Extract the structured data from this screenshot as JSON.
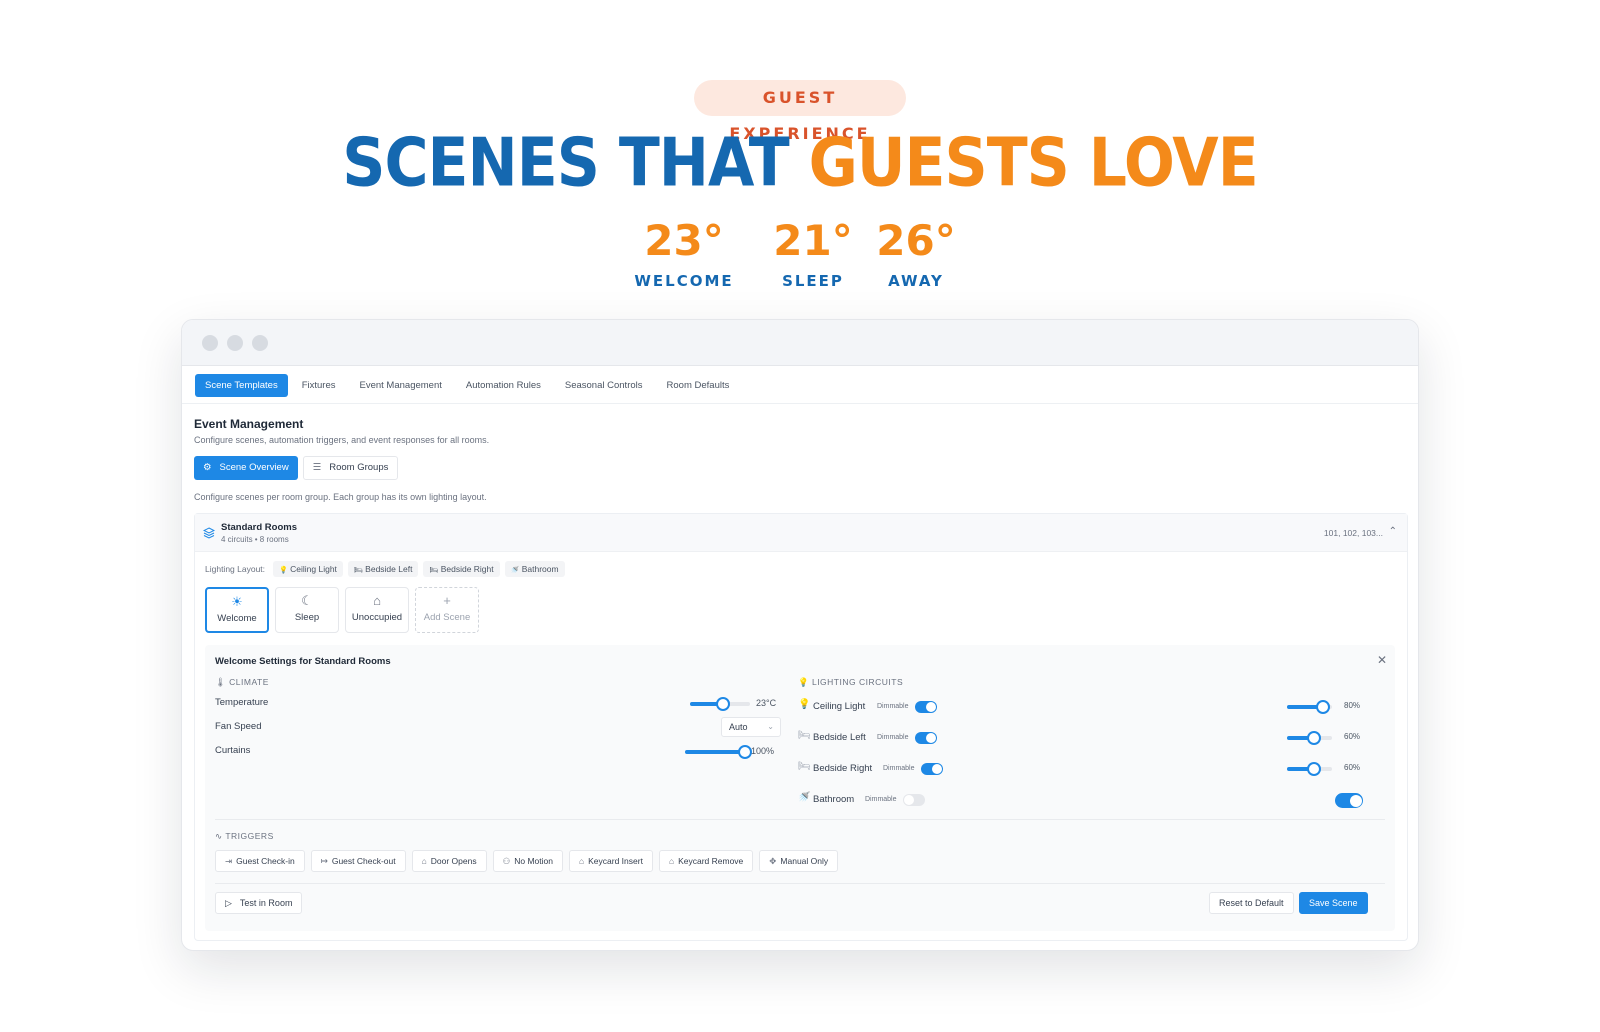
{
  "hero": {
    "pill": "GUEST EXPERIENCE",
    "headline_part1": "SCENES THAT",
    "headline_part2": "GUESTS LOVE",
    "stats": [
      {
        "value": "23°",
        "label": "WELCOME"
      },
      {
        "value": "21°",
        "label": "SLEEP"
      },
      {
        "value": "26°",
        "label": "AWAY"
      }
    ],
    "colors": {
      "blue": "#1568b0",
      "orange": "#f48a1a",
      "pill_bg": "#fde8df",
      "pill_text": "#d9532b"
    }
  },
  "app": {
    "accent": "#1e88e5",
    "tabs": [
      "Scene Templates",
      "Fixtures",
      "Event Management",
      "Automation Rules",
      "Seasonal Controls",
      "Room Defaults"
    ],
    "active_tab": "Scene Templates",
    "section": {
      "title": "Event Management",
      "subtitle": "Configure scenes, automation triggers, and event responses for all rooms."
    },
    "segments": [
      {
        "label": "Scene Overview",
        "icon": "gear-icon",
        "active": true
      },
      {
        "label": "Room Groups",
        "icon": "layers-icon",
        "active": false
      }
    ],
    "segment_description": "Configure scenes per room group. Each group has its own lighting layout.",
    "group": {
      "name": "Standard Rooms",
      "meta": "4 circuits • 8 rooms",
      "rooms": "101, 102, 103...",
      "lighting_layout_label": "Lighting Layout:",
      "lighting_layout": [
        {
          "icon": "💡",
          "label": "Ceiling Light"
        },
        {
          "icon": "🛏",
          "label": "Bedside Left"
        },
        {
          "icon": "🛏",
          "label": "Bedside Right"
        },
        {
          "icon": "🚿",
          "label": "Bathroom"
        }
      ],
      "scenes": [
        {
          "icon": "☀",
          "label": "Welcome",
          "active": true
        },
        {
          "icon": "☾",
          "label": "Sleep",
          "active": false
        },
        {
          "icon": "⌂",
          "label": "Unoccupied",
          "active": false
        },
        {
          "icon": "+",
          "label": "Add Scene",
          "active": false
        }
      ]
    },
    "settings": {
      "title": "Welcome Settings for Standard Rooms",
      "climate": {
        "heading": "CLIMATE",
        "temperature_label": "Temperature",
        "temperature_value": "23°C",
        "temperature_level": 0.55,
        "fan_label": "Fan Speed",
        "fan_value": "Auto",
        "curtains_label": "Curtains",
        "curtains_value": "100%",
        "curtains_level": 1.0
      },
      "lighting": {
        "heading": "LIGHTING CIRCUITS",
        "circuits": [
          {
            "icon": "💡",
            "label": "Ceiling Light",
            "tag": "Dimmable",
            "on": true,
            "value": "80%",
            "level": 0.8
          },
          {
            "icon": "🛏",
            "label": "Bedside Left",
            "tag": "Dimmable",
            "on": true,
            "value": "60%",
            "level": 0.6
          },
          {
            "icon": "🛏",
            "label": "Bedside Right",
            "tag": "Dimmable",
            "on": true,
            "value": "60%",
            "level": 0.6
          },
          {
            "icon": "🚿",
            "label": "Bathroom",
            "tag": "Dimmable",
            "on": false,
            "value": "",
            "level": null
          }
        ],
        "bathroom_master_on": true
      },
      "triggers": {
        "heading": "TRIGGERS",
        "items": [
          {
            "icon": "⇥",
            "label": "Guest Check-in"
          },
          {
            "icon": "↦",
            "label": "Guest Check-out"
          },
          {
            "icon": "⌂",
            "label": "Door Opens"
          },
          {
            "icon": "⚇",
            "label": "No Motion"
          },
          {
            "icon": "⌂",
            "label": "Keycard Insert"
          },
          {
            "icon": "⌂",
            "label": "Keycard Remove"
          },
          {
            "icon": "✥",
            "label": "Manual Only"
          }
        ]
      },
      "actions": {
        "test": "Test in Room",
        "reset": "Reset to Default",
        "save": "Save Scene"
      }
    }
  }
}
